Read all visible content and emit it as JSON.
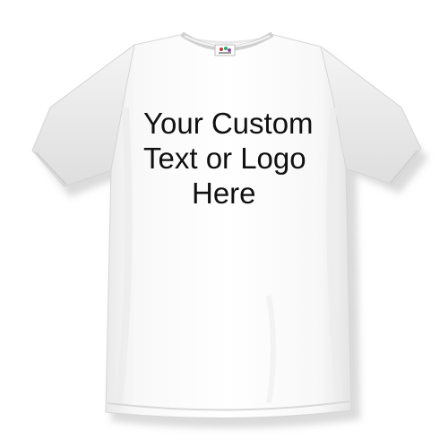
{
  "product": {
    "type": "t-shirt",
    "color": "#ffffff",
    "shadow_color": "#cfcfcf",
    "label_icon": "brand-tag-icon"
  },
  "print": {
    "line_1": "Your Custom",
    "line_2": "Text or Logo",
    "line_3": "Here",
    "text_color": "#111111"
  }
}
